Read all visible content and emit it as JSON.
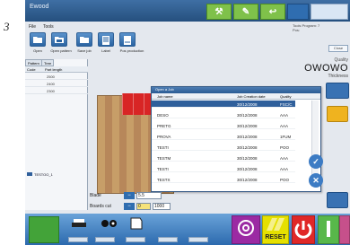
{
  "step_number": "3",
  "window": {
    "title": "Ewood"
  },
  "menu": {
    "items": [
      "File",
      "Tools"
    ]
  },
  "toolbar": {
    "buttons": [
      {
        "label": "Open"
      },
      {
        "label": "Open pattern"
      },
      {
        "label": "Save job"
      },
      {
        "label": "Label"
      },
      {
        "label": "Pos production"
      }
    ]
  },
  "right_info": {
    "line1": "Tools   Program: 7",
    "line2": "Pos:",
    "cancel": "Close"
  },
  "left_panel": {
    "tabs": [
      "Pattern",
      "Tree"
    ],
    "columns": [
      "Code",
      "Part length"
    ],
    "rows": [
      "2500",
      "2400",
      "2300"
    ],
    "file_label": "TESTOO_1"
  },
  "quality_panel": {
    "label": "Quality",
    "name": "OWOWO",
    "thickness_label": "Thickness"
  },
  "dialog": {
    "title": "Open a Job",
    "columns": [
      "Job name",
      "Job Creation date",
      "Quality"
    ],
    "rows": [
      {
        "name": "",
        "date": "30/12/2008",
        "quality": "FSC/C",
        "selected": true
      },
      {
        "name": "DESO",
        "date": "30/12/2008",
        "quality": "AAA",
        "selected": false
      },
      {
        "name": "PRETG",
        "date": "30/12/2008",
        "quality": "AAA",
        "selected": false
      },
      {
        "name": "PROVA",
        "date": "30/12/2008",
        "quality": "1FUM",
        "selected": false
      },
      {
        "name": "TESTI",
        "date": "30/12/2008",
        "quality": "POO",
        "selected": false
      },
      {
        "name": "TESTM",
        "date": "30/12/2008",
        "quality": "AAA",
        "selected": false
      },
      {
        "name": "TESTI",
        "date": "30/12/2008",
        "quality": "AAA",
        "selected": false
      },
      {
        "name": "TESTX",
        "date": "30/12/2008",
        "quality": "POO",
        "selected": false
      }
    ]
  },
  "controls": {
    "blade_label": "Blade",
    "blade_value": "5.5",
    "boards_label": "Boards cut",
    "boards_value1": "0",
    "boards_value2": "1000"
  },
  "bottom": {
    "reset_label": "RESET"
  },
  "colors": {
    "red_sheet": "#d82525",
    "toolbar_blue": "#2a63a1",
    "reset_yellow": "#e5e000",
    "power_red": "#e02828"
  }
}
